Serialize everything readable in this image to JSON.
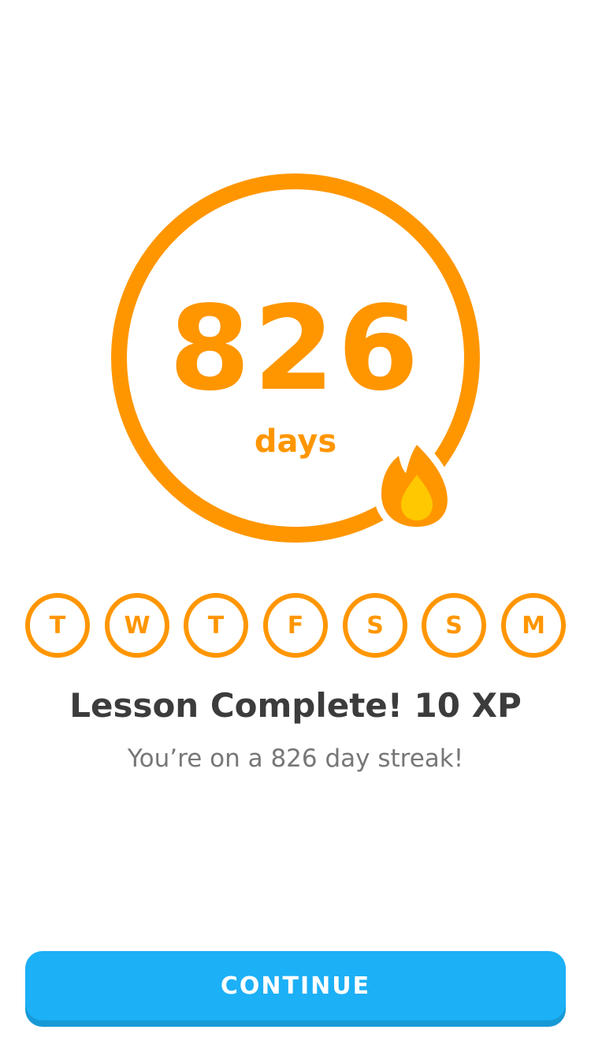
{
  "streak": {
    "count": "826",
    "unit": "days"
  },
  "week_days": [
    {
      "label": "T"
    },
    {
      "label": "W"
    },
    {
      "label": "T"
    },
    {
      "label": "F"
    },
    {
      "label": "S"
    },
    {
      "label": "S"
    },
    {
      "label": "M"
    }
  ],
  "result": {
    "title": "Lesson Complete! 10 XP",
    "subtitle": "You’re on a 826 day streak!"
  },
  "actions": {
    "continue_label": "CONTINUE"
  },
  "icons": {
    "streak": "flame-icon"
  },
  "colors": {
    "accent": "#ff9600",
    "flame_inner": "#ffc800",
    "button": "#1cb0f6",
    "button_shadow": "#1899d6",
    "title": "#3c3c3c",
    "subtitle": "#777777",
    "background": "#ffffff"
  }
}
